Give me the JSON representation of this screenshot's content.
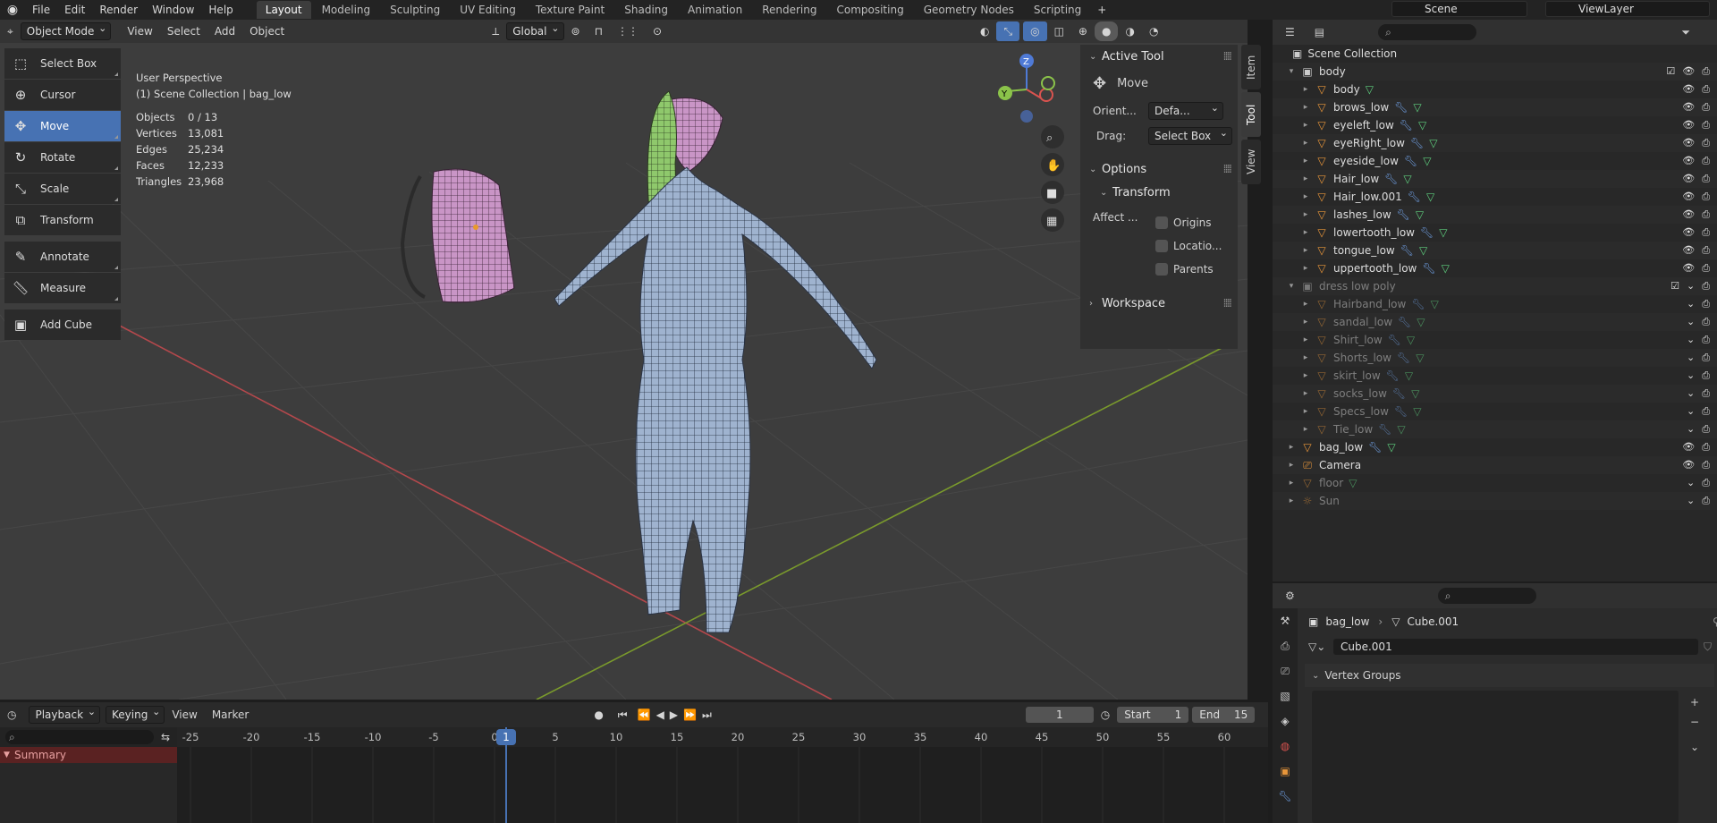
{
  "menu": {
    "file": "File",
    "edit": "Edit",
    "render": "Render",
    "window": "Window",
    "help": "Help"
  },
  "workspaces": [
    "Layout",
    "Modeling",
    "Sculpting",
    "UV Editing",
    "Texture Paint",
    "Shading",
    "Animation",
    "Rendering",
    "Compositing",
    "Geometry Nodes",
    "Scripting"
  ],
  "scene": {
    "name": "Scene",
    "view_layer": "ViewLayer"
  },
  "viewport": {
    "mode": "Object Mode",
    "menus": [
      "View",
      "Select",
      "Add",
      "Object"
    ],
    "transform_orientation": "Global",
    "perspective": "User Perspective",
    "collection_path": "(1) Scene Collection | bag_low",
    "stats": [
      {
        "k": "Objects",
        "v": "0 / 13"
      },
      {
        "k": "Vertices",
        "v": "13,081"
      },
      {
        "k": "Edges",
        "v": "25,234"
      },
      {
        "k": "Faces",
        "v": "12,233"
      },
      {
        "k": "Triangles",
        "v": "23,968"
      }
    ]
  },
  "tools": [
    {
      "label": "Select Box",
      "icon": "select-box-icon",
      "active": false
    },
    {
      "label": "Cursor",
      "icon": "cursor-icon",
      "active": false
    },
    {
      "label": "Move",
      "icon": "move-icon",
      "active": true
    },
    {
      "label": "Rotate",
      "icon": "rotate-icon",
      "active": false
    },
    {
      "label": "Scale",
      "icon": "scale-icon",
      "active": false
    },
    {
      "label": "Transform",
      "icon": "transform-icon",
      "active": false
    },
    {
      "label": "Annotate",
      "icon": "annotate-icon",
      "active": false
    },
    {
      "label": "Measure",
      "icon": "measure-icon",
      "active": false
    },
    {
      "label": "Add Cube",
      "icon": "add-cube-icon",
      "active": false
    }
  ],
  "npanel": {
    "active_tool_header": "Active Tool",
    "tool_name": "Move",
    "orient_label": "Orient...",
    "orient_value": "Defa...",
    "drag_label": "Drag:",
    "drag_value": "Select Box",
    "options_header": "Options",
    "transform_header": "Transform",
    "affect_label": "Affect ...",
    "affect_options": [
      "Origins",
      "Locatio...",
      "Parents"
    ],
    "workspace_header": "Workspace",
    "tabs": [
      "Item",
      "Tool",
      "View"
    ]
  },
  "outliner": {
    "root": "Scene Collection",
    "rows": [
      {
        "name": "body",
        "kind": "collection",
        "level": 0,
        "dim": false
      },
      {
        "name": "body",
        "kind": "object",
        "level": 1,
        "dim": false
      },
      {
        "name": "brows_low",
        "kind": "object",
        "level": 1,
        "dim": false
      },
      {
        "name": "eyeleft_low",
        "kind": "object",
        "level": 1,
        "dim": false
      },
      {
        "name": "eyeRight_low",
        "kind": "object",
        "level": 1,
        "dim": false
      },
      {
        "name": "eyeside_low",
        "kind": "object",
        "level": 1,
        "dim": false
      },
      {
        "name": "Hair_low",
        "kind": "object",
        "level": 1,
        "dim": false
      },
      {
        "name": "Hair_low.001",
        "kind": "object",
        "level": 1,
        "dim": false
      },
      {
        "name": "lashes_low",
        "kind": "object",
        "level": 1,
        "dim": false
      },
      {
        "name": "lowertooth_low",
        "kind": "object",
        "level": 1,
        "dim": false
      },
      {
        "name": "tongue_low",
        "kind": "object",
        "level": 1,
        "dim": false
      },
      {
        "name": "uppertooth_low",
        "kind": "object",
        "level": 1,
        "dim": false
      },
      {
        "name": "dress low poly",
        "kind": "collection",
        "level": 0,
        "dim": true
      },
      {
        "name": "Hairband_low",
        "kind": "object",
        "level": 1,
        "dim": true
      },
      {
        "name": "sandal_low",
        "kind": "object",
        "level": 1,
        "dim": true
      },
      {
        "name": "Shirt_low",
        "kind": "object",
        "level": 1,
        "dim": true
      },
      {
        "name": "Shorts_low",
        "kind": "object",
        "level": 1,
        "dim": true
      },
      {
        "name": "skirt_low",
        "kind": "object",
        "level": 1,
        "dim": true
      },
      {
        "name": "socks_low",
        "kind": "object",
        "level": 1,
        "dim": true
      },
      {
        "name": "Specs_low",
        "kind": "object",
        "level": 1,
        "dim": true
      },
      {
        "name": "Tie_low",
        "kind": "object",
        "level": 1,
        "dim": true
      },
      {
        "name": "bag_low",
        "kind": "object",
        "level": 0,
        "dim": false
      },
      {
        "name": "Camera",
        "kind": "camera",
        "level": 0,
        "dim": false
      },
      {
        "name": "floor",
        "kind": "object",
        "level": 0,
        "dim": true
      },
      {
        "name": "Sun",
        "kind": "light",
        "level": 0,
        "dim": true
      }
    ]
  },
  "properties": {
    "object": "bag_low",
    "mesh": "Cube.001",
    "mesh_field": "Cube.001",
    "section": "Vertex Groups"
  },
  "timeline": {
    "menus": [
      "Playback",
      "Keying",
      "View",
      "Marker"
    ],
    "current_frame": "1",
    "start_label": "Start",
    "start": "1",
    "end_label": "End",
    "end": "15",
    "ruler": [
      "-25",
      "-20",
      "-15",
      "-10",
      "-5",
      "0",
      "5",
      "10",
      "15",
      "20",
      "25",
      "30",
      "35",
      "40",
      "45",
      "50",
      "55",
      "60"
    ],
    "summary": "Summary"
  },
  "colors": {
    "accent": "#4772b3",
    "object_icon": "#e8963a",
    "mesh_icon": "#5ecf7e",
    "modifier_icon": "#6e9de0"
  }
}
